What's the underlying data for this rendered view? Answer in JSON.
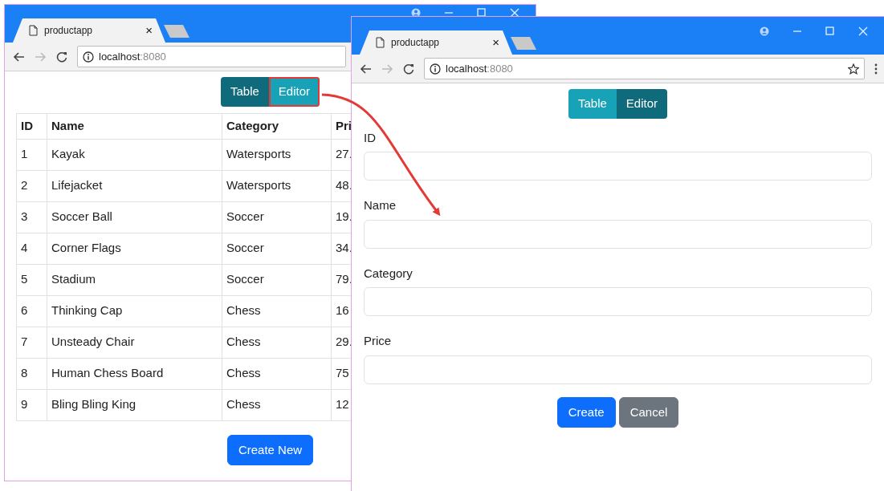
{
  "windows": [
    {
      "kind": "table",
      "tab_title": "productapp",
      "tab_close": "×",
      "url_host": "localhost",
      "url_port": ":8080",
      "nav_buttons": [
        {
          "label": "Table",
          "selected": true,
          "highlighted": false
        },
        {
          "label": "Editor",
          "selected": false,
          "highlighted": true
        }
      ],
      "table": {
        "columns": [
          "ID",
          "Name",
          "Category",
          "Pri"
        ],
        "rows": [
          [
            "1",
            "Kayak",
            "Watersports",
            "27."
          ],
          [
            "2",
            "Lifejacket",
            "Watersports",
            "48."
          ],
          [
            "3",
            "Soccer Ball",
            "Soccer",
            "19."
          ],
          [
            "4",
            "Corner Flags",
            "Soccer",
            "34."
          ],
          [
            "5",
            "Stadium",
            "Soccer",
            "79."
          ],
          [
            "6",
            "Thinking Cap",
            "Chess",
            "16"
          ],
          [
            "7",
            "Unsteady Chair",
            "Chess",
            "29."
          ],
          [
            "8",
            "Human Chess Board",
            "Chess",
            "75"
          ],
          [
            "9",
            "Bling Bling King",
            "Chess",
            "12"
          ]
        ]
      },
      "create_button": "Create New"
    },
    {
      "kind": "editor",
      "tab_title": "productapp",
      "tab_close": "×",
      "url_host": "localhost",
      "url_port": ":8080",
      "nav_buttons": [
        {
          "label": "Table",
          "selected": false,
          "highlighted": false
        },
        {
          "label": "Editor",
          "selected": true,
          "highlighted": false
        }
      ],
      "form": {
        "fields": [
          {
            "label": "ID"
          },
          {
            "label": "Name"
          },
          {
            "label": "Category"
          },
          {
            "label": "Price"
          }
        ]
      },
      "buttons": [
        {
          "label": "Create",
          "kind": "primary"
        },
        {
          "label": "Cancel",
          "kind": "secondary"
        }
      ]
    }
  ]
}
